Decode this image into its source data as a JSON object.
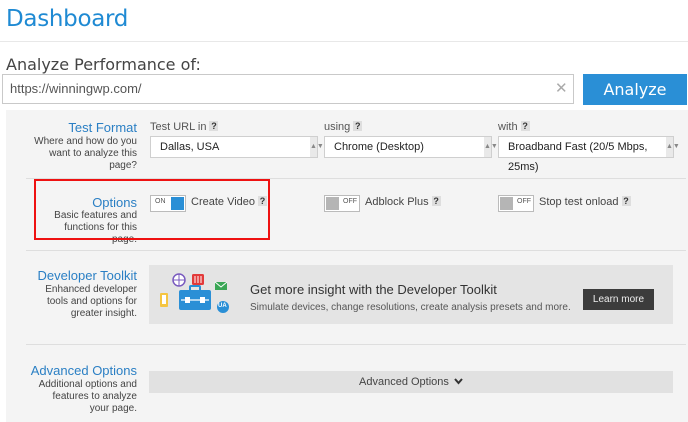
{
  "page": {
    "title": "Dashboard",
    "subtitle": "Analyze Performance of:"
  },
  "url_bar": {
    "value": "https://winningwp.com/",
    "clear_icon": "✕",
    "analyze_label": "Analyze"
  },
  "test_format": {
    "title": "Test Format",
    "description": "Where and how do you want to analyze this page?",
    "location": {
      "label": "Test URL in",
      "help": "?",
      "value": "Dallas, USA"
    },
    "browser": {
      "label": "using",
      "help": "?",
      "value": "Chrome (Desktop)"
    },
    "connection": {
      "label": "with",
      "help": "?",
      "value": "Broadband Fast (20/5 Mbps, 25ms)"
    },
    "dropdown_icon": "▲▼"
  },
  "options": {
    "title": "Options",
    "description": "Basic features and functions for this page.",
    "items": [
      {
        "label": "Create Video",
        "state": "ON",
        "enabled": true,
        "help": "?"
      },
      {
        "label": "Adblock Plus",
        "state": "OFF",
        "enabled": false,
        "help": "?"
      },
      {
        "label": "Stop test onload",
        "state": "OFF",
        "enabled": false,
        "help": "?"
      }
    ]
  },
  "developer_toolkit": {
    "title": "Developer Toolkit",
    "description": "Enhanced developer tools and options for greater insight.",
    "banner_title": "Get more insight with the Developer Toolkit",
    "banner_desc": "Simulate devices, change resolutions, create analysis presets and more.",
    "button_label": "Learn more",
    "icon_badge": "UA"
  },
  "advanced_options": {
    "title": "Advanced Options",
    "description": "Additional options and features to analyze your page.",
    "toggle_label": "Advanced Options",
    "chevron": "⌵"
  },
  "colors": {
    "accent": "#2a8fd6",
    "highlight": "#e11111",
    "toggle_on": "#2a8fd6",
    "toggle_off": "#b5b5b5"
  }
}
